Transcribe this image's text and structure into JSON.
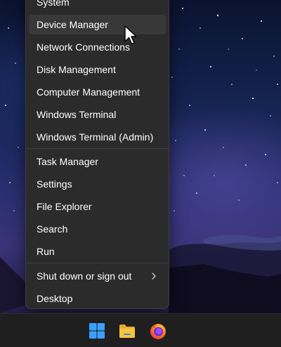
{
  "context_menu": {
    "items": [
      {
        "label": "System"
      },
      {
        "label": "Device Manager"
      },
      {
        "label": "Network Connections"
      },
      {
        "label": "Disk Management"
      },
      {
        "label": "Computer Management"
      },
      {
        "label": "Windows Terminal"
      },
      {
        "label": "Windows Terminal (Admin)"
      },
      {
        "label": "Task Manager"
      },
      {
        "label": "Settings"
      },
      {
        "label": "File Explorer"
      },
      {
        "label": "Search"
      },
      {
        "label": "Run"
      },
      {
        "label": "Shut down or sign out"
      },
      {
        "label": "Desktop"
      }
    ],
    "hovered_item": "Device Manager"
  },
  "taskbar": {
    "icons": [
      "windows-start-icon",
      "file-explorer-icon",
      "firefox-icon"
    ]
  },
  "colors": {
    "menu_background": "#2b2b2b",
    "menu_hover": "#383838",
    "taskbar": "#1f1f1f",
    "start_blue": "#3aa0ff",
    "folder_yellow": "#f6c443"
  }
}
